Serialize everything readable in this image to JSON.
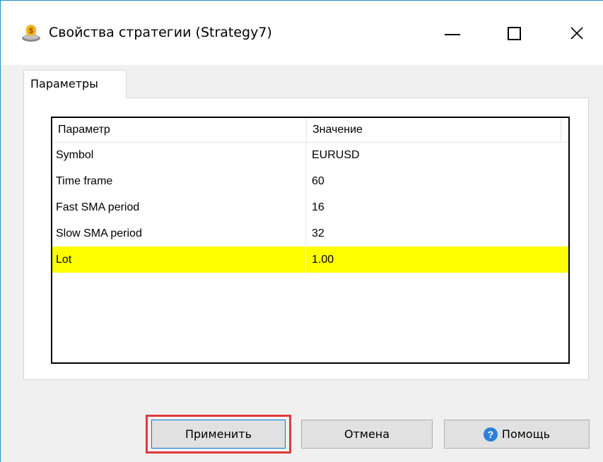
{
  "window": {
    "title": "Свойства стратегии (Strategy7)",
    "icon": "money-bag-icon"
  },
  "tabs": [
    {
      "label": "Параметры",
      "active": true
    }
  ],
  "grid": {
    "columns": [
      "Параметр",
      "Значение"
    ],
    "rows": [
      {
        "name": "Symbol",
        "value": "EURUSD"
      },
      {
        "name": "Time frame",
        "value": "60"
      },
      {
        "name": "Fast SMA period",
        "value": "16"
      },
      {
        "name": "Slow SMA period",
        "value": "32"
      },
      {
        "name": "Lot",
        "value": "1.00",
        "selected": true
      }
    ],
    "selected_color": "#ffff00"
  },
  "buttons": {
    "apply": "Применить",
    "cancel": "Отмена",
    "help": "Помощь"
  },
  "colors": {
    "highlight_outline": "#e0393e",
    "window_border": "#1e8fcf"
  }
}
